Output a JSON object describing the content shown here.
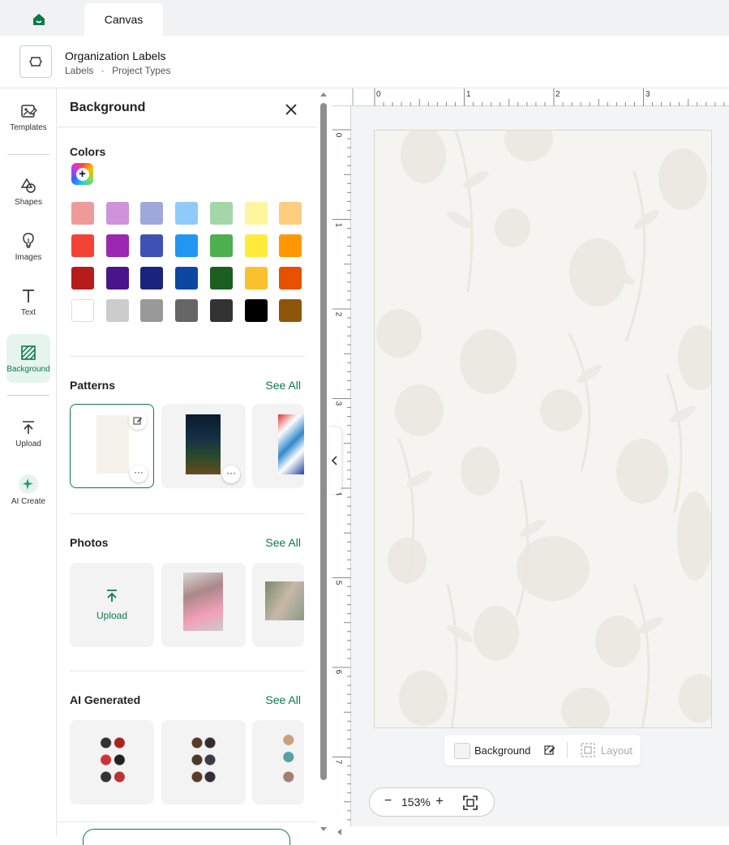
{
  "topbar": {
    "tab_label": "Canvas"
  },
  "header": {
    "project_title": "Organization Labels",
    "breadcrumb_1": "Labels",
    "separator": "·",
    "breadcrumb_2": "Project Types"
  },
  "rail": {
    "items": [
      {
        "label": "Templates",
        "icon": "templates-icon"
      },
      {
        "label": "Shapes",
        "icon": "shapes-icon"
      },
      {
        "label": "Images",
        "icon": "lightbulb-icon"
      },
      {
        "label": "Text",
        "icon": "text-icon"
      },
      {
        "label": "Background",
        "icon": "background-icon",
        "active": true
      },
      {
        "label": "Upload",
        "icon": "upload-icon"
      },
      {
        "label": "AI Create",
        "icon": "sparkle-icon"
      }
    ]
  },
  "panel": {
    "title": "Background",
    "colors_title": "Colors",
    "colors": [
      [
        "#ef9a9a",
        "#ce93d8",
        "#9fa8da",
        "#90caf9",
        "#a5d6a7",
        "#fff59d",
        "#ffcc80"
      ],
      [
        "#f44336",
        "#9c27b0",
        "#3f51b5",
        "#2196f3",
        "#4caf50",
        "#ffeb3b",
        "#ff9800"
      ],
      [
        "#b71c1c",
        "#4a148c",
        "#1a237e",
        "#0d47a1",
        "#1b5e20",
        "#fbc02d",
        "#e65100"
      ],
      [
        "#ffffff",
        "#cccccc",
        "#999999",
        "#666666",
        "#333333",
        "#000000",
        "#8d5508"
      ]
    ],
    "patterns_title": "Patterns",
    "photos_title": "Photos",
    "ai_title": "AI Generated",
    "see_all": "See All",
    "upload_label": "Upload",
    "more_label": "···"
  },
  "ruler": {
    "h_labels": [
      "0",
      "1",
      "2",
      "3"
    ],
    "v_labels": [
      "0",
      "1",
      "2",
      "3",
      "4",
      "5",
      "6",
      "7"
    ]
  },
  "canvas": {
    "background_color": "#f5f4f0"
  },
  "bottombar": {
    "background_label": "Background",
    "layout_label": "Layout"
  },
  "zoom": {
    "minus": "−",
    "level": "153%",
    "plus": "+"
  },
  "accent": "#0b7a4b"
}
